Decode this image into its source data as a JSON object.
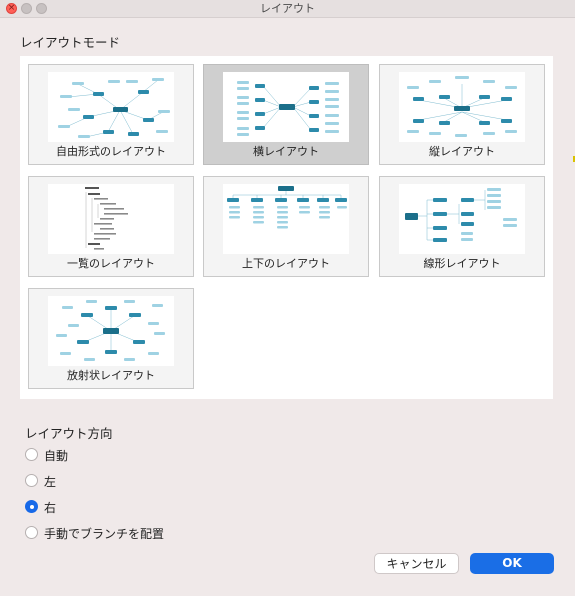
{
  "window": {
    "title": "レイアウト"
  },
  "layout_mode": {
    "heading": "レイアウトモード",
    "selected_index": 1,
    "tiles": [
      {
        "label": "自由形式のレイアウト"
      },
      {
        "label": "横レイアウト"
      },
      {
        "label": "縦レイアウト"
      },
      {
        "label": "一覧のレイアウト"
      },
      {
        "label": "上下のレイアウト"
      },
      {
        "label": "線形レイアウト"
      },
      {
        "label": "放射状レイアウト"
      }
    ]
  },
  "direction": {
    "heading": "レイアウト方向",
    "selected_index": 2,
    "options": [
      {
        "label": "自動"
      },
      {
        "label": "左"
      },
      {
        "label": "右"
      },
      {
        "label": "手動でブランチを配置"
      }
    ]
  },
  "buttons": {
    "cancel": "キャンセル",
    "ok": "OK"
  },
  "colors": {
    "accent": "#1a6ee6",
    "node": "#1b6f8a",
    "node_light": "#5fb6d3"
  }
}
